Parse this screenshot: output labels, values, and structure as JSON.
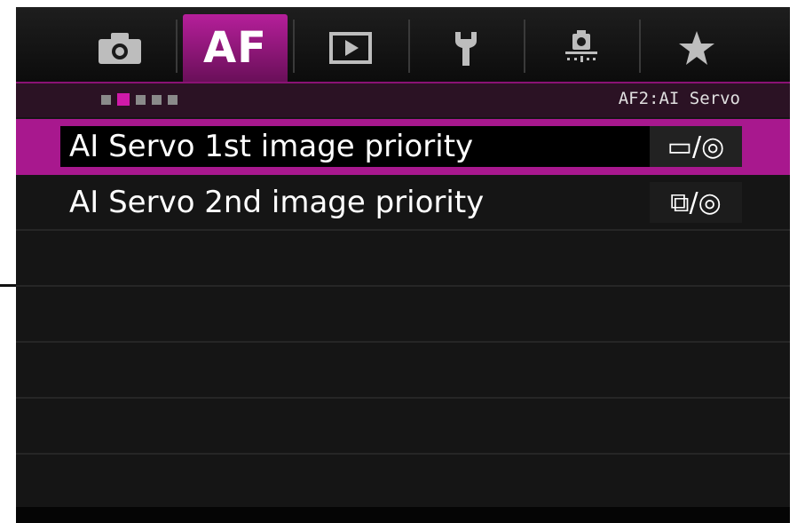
{
  "tabs": [
    {
      "id": "shooting",
      "icon": "camera-icon",
      "active": false
    },
    {
      "id": "af",
      "label": "AF",
      "active": true
    },
    {
      "id": "playback",
      "icon": "play-icon",
      "active": false
    },
    {
      "id": "setup",
      "icon": "wrench-icon",
      "active": false
    },
    {
      "id": "custom",
      "icon": "custom-function-icon",
      "active": false
    },
    {
      "id": "mymenu",
      "icon": "star-icon",
      "active": false
    }
  ],
  "subheader": {
    "page_count": 5,
    "active_page": 2,
    "page_label": "AF2:AI Servo"
  },
  "menu_items": [
    {
      "label": "AI Servo 1st image priority",
      "value": "▭/◎",
      "selected": true
    },
    {
      "label": "AI Servo 2nd image priority",
      "value": "⧉/◎",
      "selected": false
    }
  ],
  "colors": {
    "accent": "#a8188e",
    "background": "#151515"
  }
}
